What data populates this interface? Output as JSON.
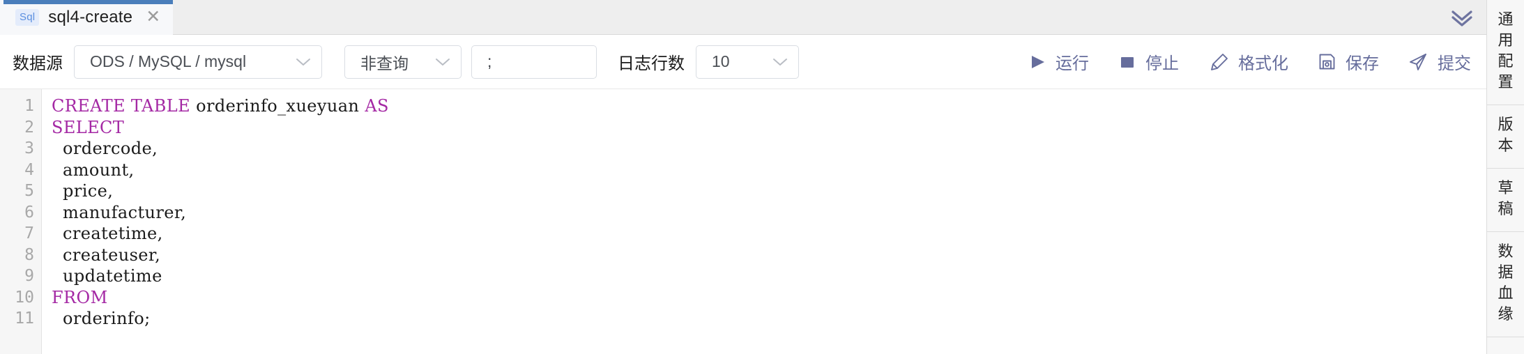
{
  "tab": {
    "badge": "Sql",
    "title": "sql4-create",
    "close_icon": "close-icon",
    "collapse_icon": "double-chevron-down-icon"
  },
  "toolbar": {
    "datasource_label": "数据源",
    "datasource_value": "ODS / MySQL / mysql",
    "query_type_value": "非查询",
    "separator_value": ";",
    "log_rows_label": "日志行数",
    "log_rows_value": "10",
    "actions": [
      {
        "label": "运行",
        "icon": "play-icon"
      },
      {
        "label": "停止",
        "icon": "stop-square-icon"
      },
      {
        "label": "格式化",
        "icon": "brush-icon"
      },
      {
        "label": "保存",
        "icon": "save-disk-icon"
      },
      {
        "label": "提交",
        "icon": "send-paperplane-icon"
      }
    ],
    "accent_color": "#666d9c"
  },
  "editor": {
    "line_numbers": [
      "1",
      "2",
      "3",
      "4",
      "5",
      "6",
      "7",
      "8",
      "9",
      "10",
      "11"
    ],
    "lines": [
      [
        {
          "t": "CREATE TABLE",
          "k": true
        },
        {
          "t": " orderinfo_xueyuan ",
          "k": false
        },
        {
          "t": "AS",
          "k": true
        }
      ],
      [
        {
          "t": "SELECT",
          "k": true
        }
      ],
      [
        {
          "t": "  ordercode,",
          "k": false
        }
      ],
      [
        {
          "t": "  amount,",
          "k": false
        }
      ],
      [
        {
          "t": "  price,",
          "k": false
        }
      ],
      [
        {
          "t": "  manufacturer,",
          "k": false
        }
      ],
      [
        {
          "t": "  createtime,",
          "k": false
        }
      ],
      [
        {
          "t": "  createuser,",
          "k": false
        }
      ],
      [
        {
          "t": "  updatetime",
          "k": false
        }
      ],
      [
        {
          "t": "FROM",
          "k": true
        }
      ],
      [
        {
          "t": "  orderinfo;",
          "k": false
        }
      ]
    ],
    "keyword_color": "#a428a4"
  },
  "sidebar": {
    "items": [
      {
        "label": "通用配置"
      },
      {
        "label": "版本"
      },
      {
        "label": "草稿"
      },
      {
        "label": "数据血缘"
      }
    ]
  }
}
